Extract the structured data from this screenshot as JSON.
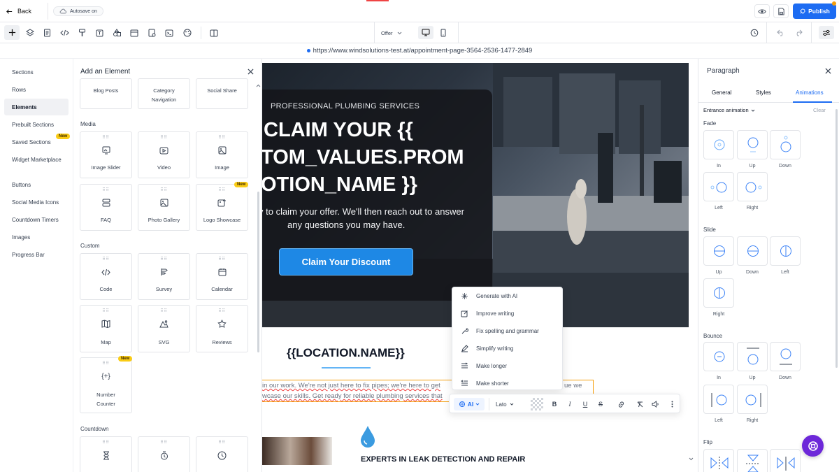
{
  "topbar": {
    "back_label": "Back",
    "autosave_label": "Autosave on",
    "publish_label": "Publish"
  },
  "toolbar": {
    "device_select": "Offer"
  },
  "url": "https://www.windsolutions-test.at/appointment-page-3564-2536-1477-2849",
  "leftnav": {
    "items": [
      "Sections",
      "Rows",
      "Elements",
      "Prebuilt Sections",
      "Saved Sections",
      "Widget Marketplace",
      "Buttons",
      "Social Media Icons",
      "Countdown Timers",
      "Images",
      "Progress Bar"
    ],
    "active": "Elements",
    "new_badge": "New"
  },
  "elpanel": {
    "title": "Add an Element",
    "top_row": [
      "Blog Posts",
      "Category Navigation",
      "Social Share"
    ],
    "media_heading": "Media",
    "media": [
      "Image Slider",
      "Video",
      "Image",
      "FAQ",
      "Photo Gallery",
      "Logo Showcase"
    ],
    "custom_heading": "Custom",
    "custom": [
      "Code",
      "Survey",
      "Calendar",
      "Map",
      "SVG",
      "Reviews",
      "Number Counter"
    ],
    "countdown_heading": "Countdown",
    "new_badge": "New"
  },
  "hero": {
    "kicker": "PROFESSIONAL PLUMBING SERVICES",
    "title_lines": [
      "CLAIM YOUR {{",
      "TOM_VALUES.PROM",
      "OTION_NAME }}"
    ],
    "body_line1": "y to claim your offer. We'll then reach out to answer",
    "body_line2": "any questions you may have.",
    "cta": "Claim Your Discount"
  },
  "location": {
    "title": "{{LOCATION.NAME}}"
  },
  "paragraph": {
    "line1": "in our work. We're not just here to fix pipes; we're here to get",
    "line1_end": "ue we",
    "line2": "wcase our skills. Get ready for reliable plumbing services that"
  },
  "feature": {
    "title": "EXPERTS IN LEAK DETECTION AND REPAIR"
  },
  "ai_menu": [
    "Generate with AI",
    "Improve writing",
    "Fix spelling and grammar",
    "Simplify writing",
    "Make longer",
    "Make shorter"
  ],
  "fmtbar": {
    "ai_label": "AI",
    "font_label": "Lato"
  },
  "rpanel": {
    "title": "Paragraph",
    "tabs": [
      "General",
      "Styles",
      "Animations"
    ],
    "active_tab": "Animations",
    "entrance_label": "Entrance animation",
    "clear_label": "Clear",
    "fade_heading": "Fade",
    "fade": [
      "In",
      "Up",
      "Down",
      "Left",
      "Right"
    ],
    "slide_heading": "Slide",
    "slide": [
      "Up",
      "Down",
      "Left",
      "Right"
    ],
    "bounce_heading": "Bounce",
    "bounce": [
      "In",
      "Up",
      "Down",
      "Left",
      "Right"
    ],
    "flip_heading": "Flip"
  },
  "colors": {
    "accent": "#1d6cf2",
    "cta": "#1e88e5",
    "badge": "#facc15",
    "fab": "#6d28d9"
  }
}
